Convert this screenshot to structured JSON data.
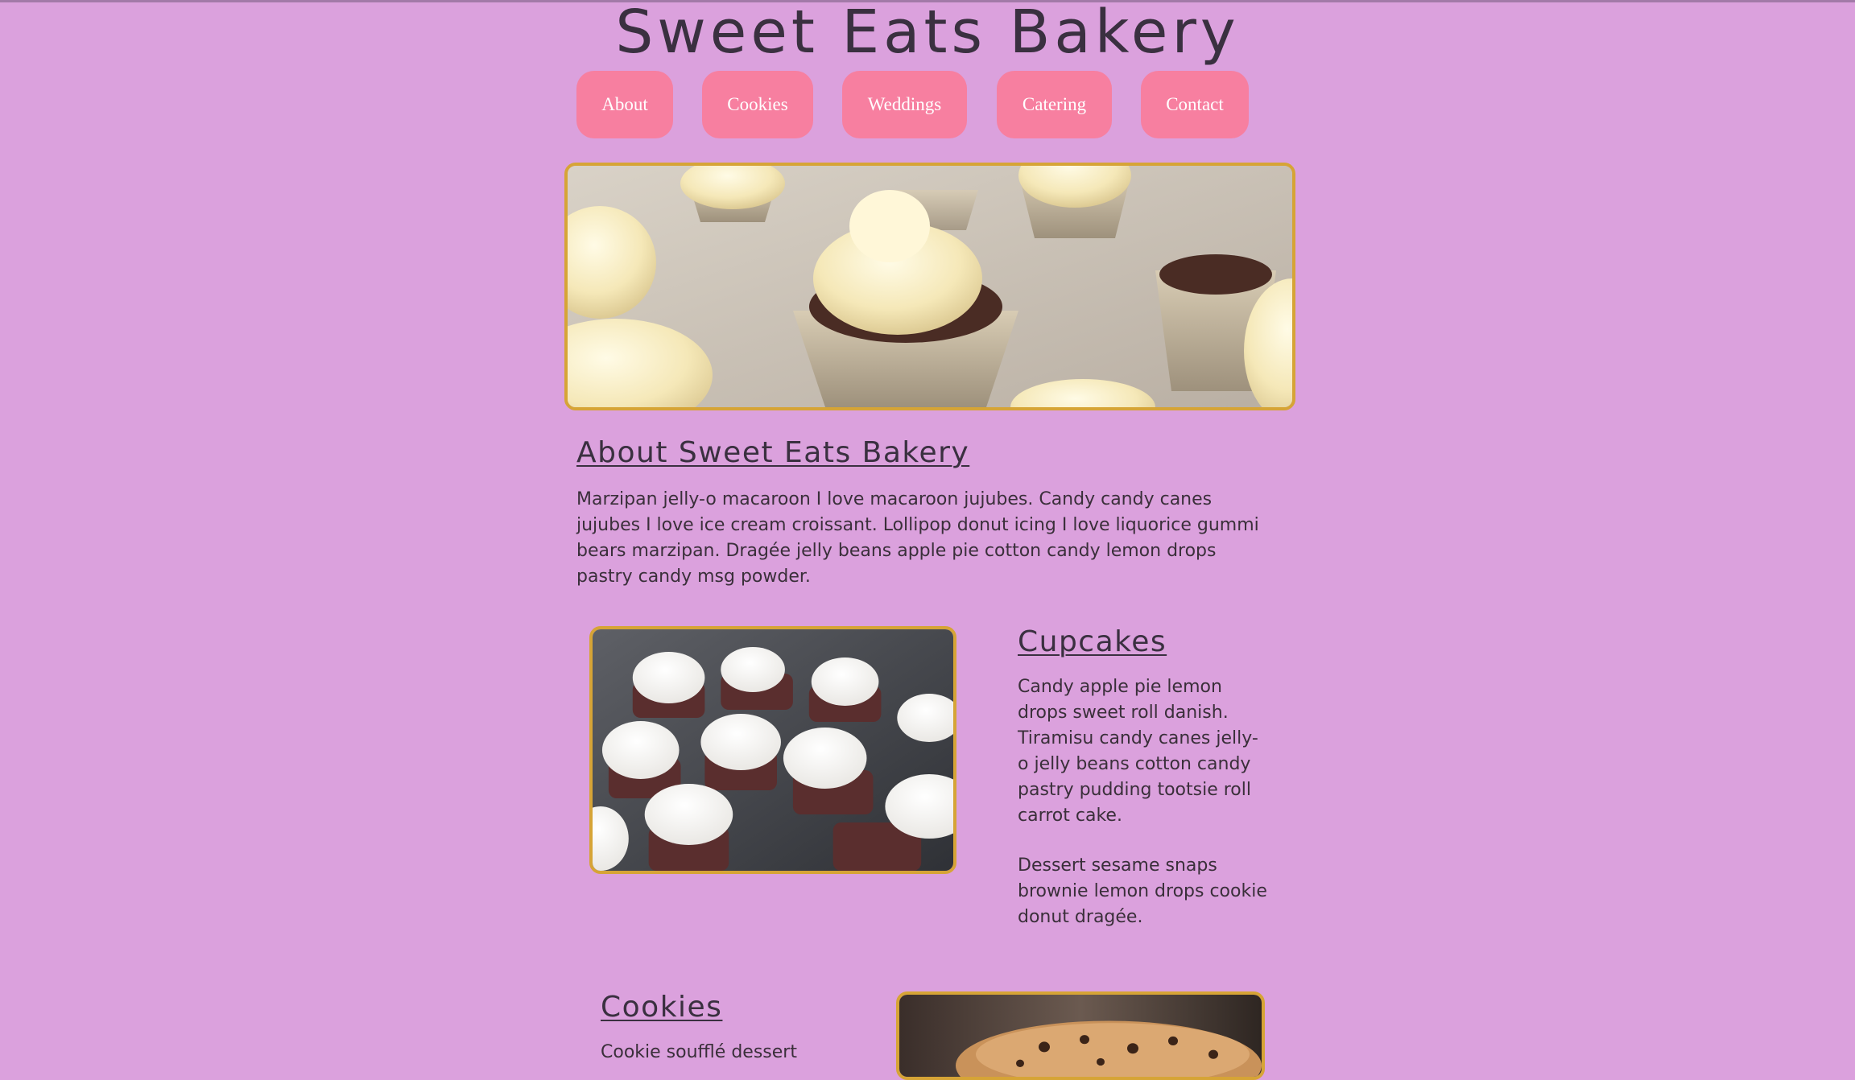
{
  "site": {
    "title": "Sweet Eats Bakery"
  },
  "nav": {
    "items": [
      "About",
      "Cookies",
      "Weddings",
      "Catering",
      "Contact"
    ]
  },
  "colors": {
    "background": "#dba1dd",
    "button": "#f77fa0",
    "frame": "#d6a436",
    "text": "#3a2f3a"
  },
  "about": {
    "heading": "About Sweet Eats Bakery",
    "text": "Marzipan jelly-o macaroon I love macaroon jujubes. Candy candy canes jujubes I love ice cream croissant. Lollipop donut icing I love liquorice gummi bears marzipan. Dragée jelly beans apple pie cotton candy lemon drops pastry candy msg powder."
  },
  "cupcakes": {
    "heading": "Cupcakes",
    "text1": "Candy apple pie lemon drops sweet roll danish. Tiramisu candy canes jelly-o jelly beans cotton candy pastry pudding tootsie roll carrot cake.",
    "text2": "Dessert sesame snaps brownie lemon drops cookie donut dragée."
  },
  "cookies": {
    "heading": "Cookies",
    "text1": "Cookie soufflé dessert"
  },
  "images": {
    "hero": "cupcakes-hero-photo",
    "cupcakes": "chocolate-cupcakes-photo",
    "cookies": "chocolate-chip-cookies-photo"
  }
}
